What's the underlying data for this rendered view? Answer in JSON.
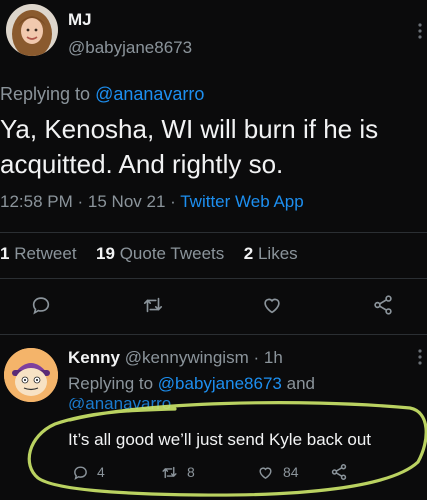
{
  "tweet": {
    "display_name": "MJ",
    "handle": "@babyjane8673",
    "replying_prefix": "Replying to ",
    "replying_to": "@ananavarro",
    "text_line1": "Ya, Kenosha, WI will burn if he is",
    "text_line2": "acquitted. And rightly so.",
    "time": "12:58 PM",
    "date": "15 Nov 21",
    "sep": "·",
    "source": "Twitter Web App"
  },
  "stats": {
    "retweets_count": "1",
    "retweets_label": "Retweet",
    "quotes_count": "19",
    "quotes_label": "Quote Tweets",
    "likes_count": "2",
    "likes_label": "Likes"
  },
  "reply": {
    "display_name": "Kenny",
    "handle": "@kennywingism",
    "sep": "·",
    "age": "1h",
    "replying_prefix": "Replying to ",
    "replying_to": "@babyjane8673",
    "replying_and": "and",
    "replying_to2": "@ananavarro",
    "text": "It’s all good we’ll just send Kyle back out",
    "reply_count": "4",
    "retweet_count": "8",
    "like_count": "84"
  },
  "colors": {
    "background": "#0b0b0c",
    "link": "#1d8ff0",
    "muted": "#8b949b",
    "highlight_circle": "#cde86a"
  },
  "icons": [
    "reply-icon",
    "retweet-icon",
    "like-icon",
    "share-icon",
    "more-icon"
  ]
}
